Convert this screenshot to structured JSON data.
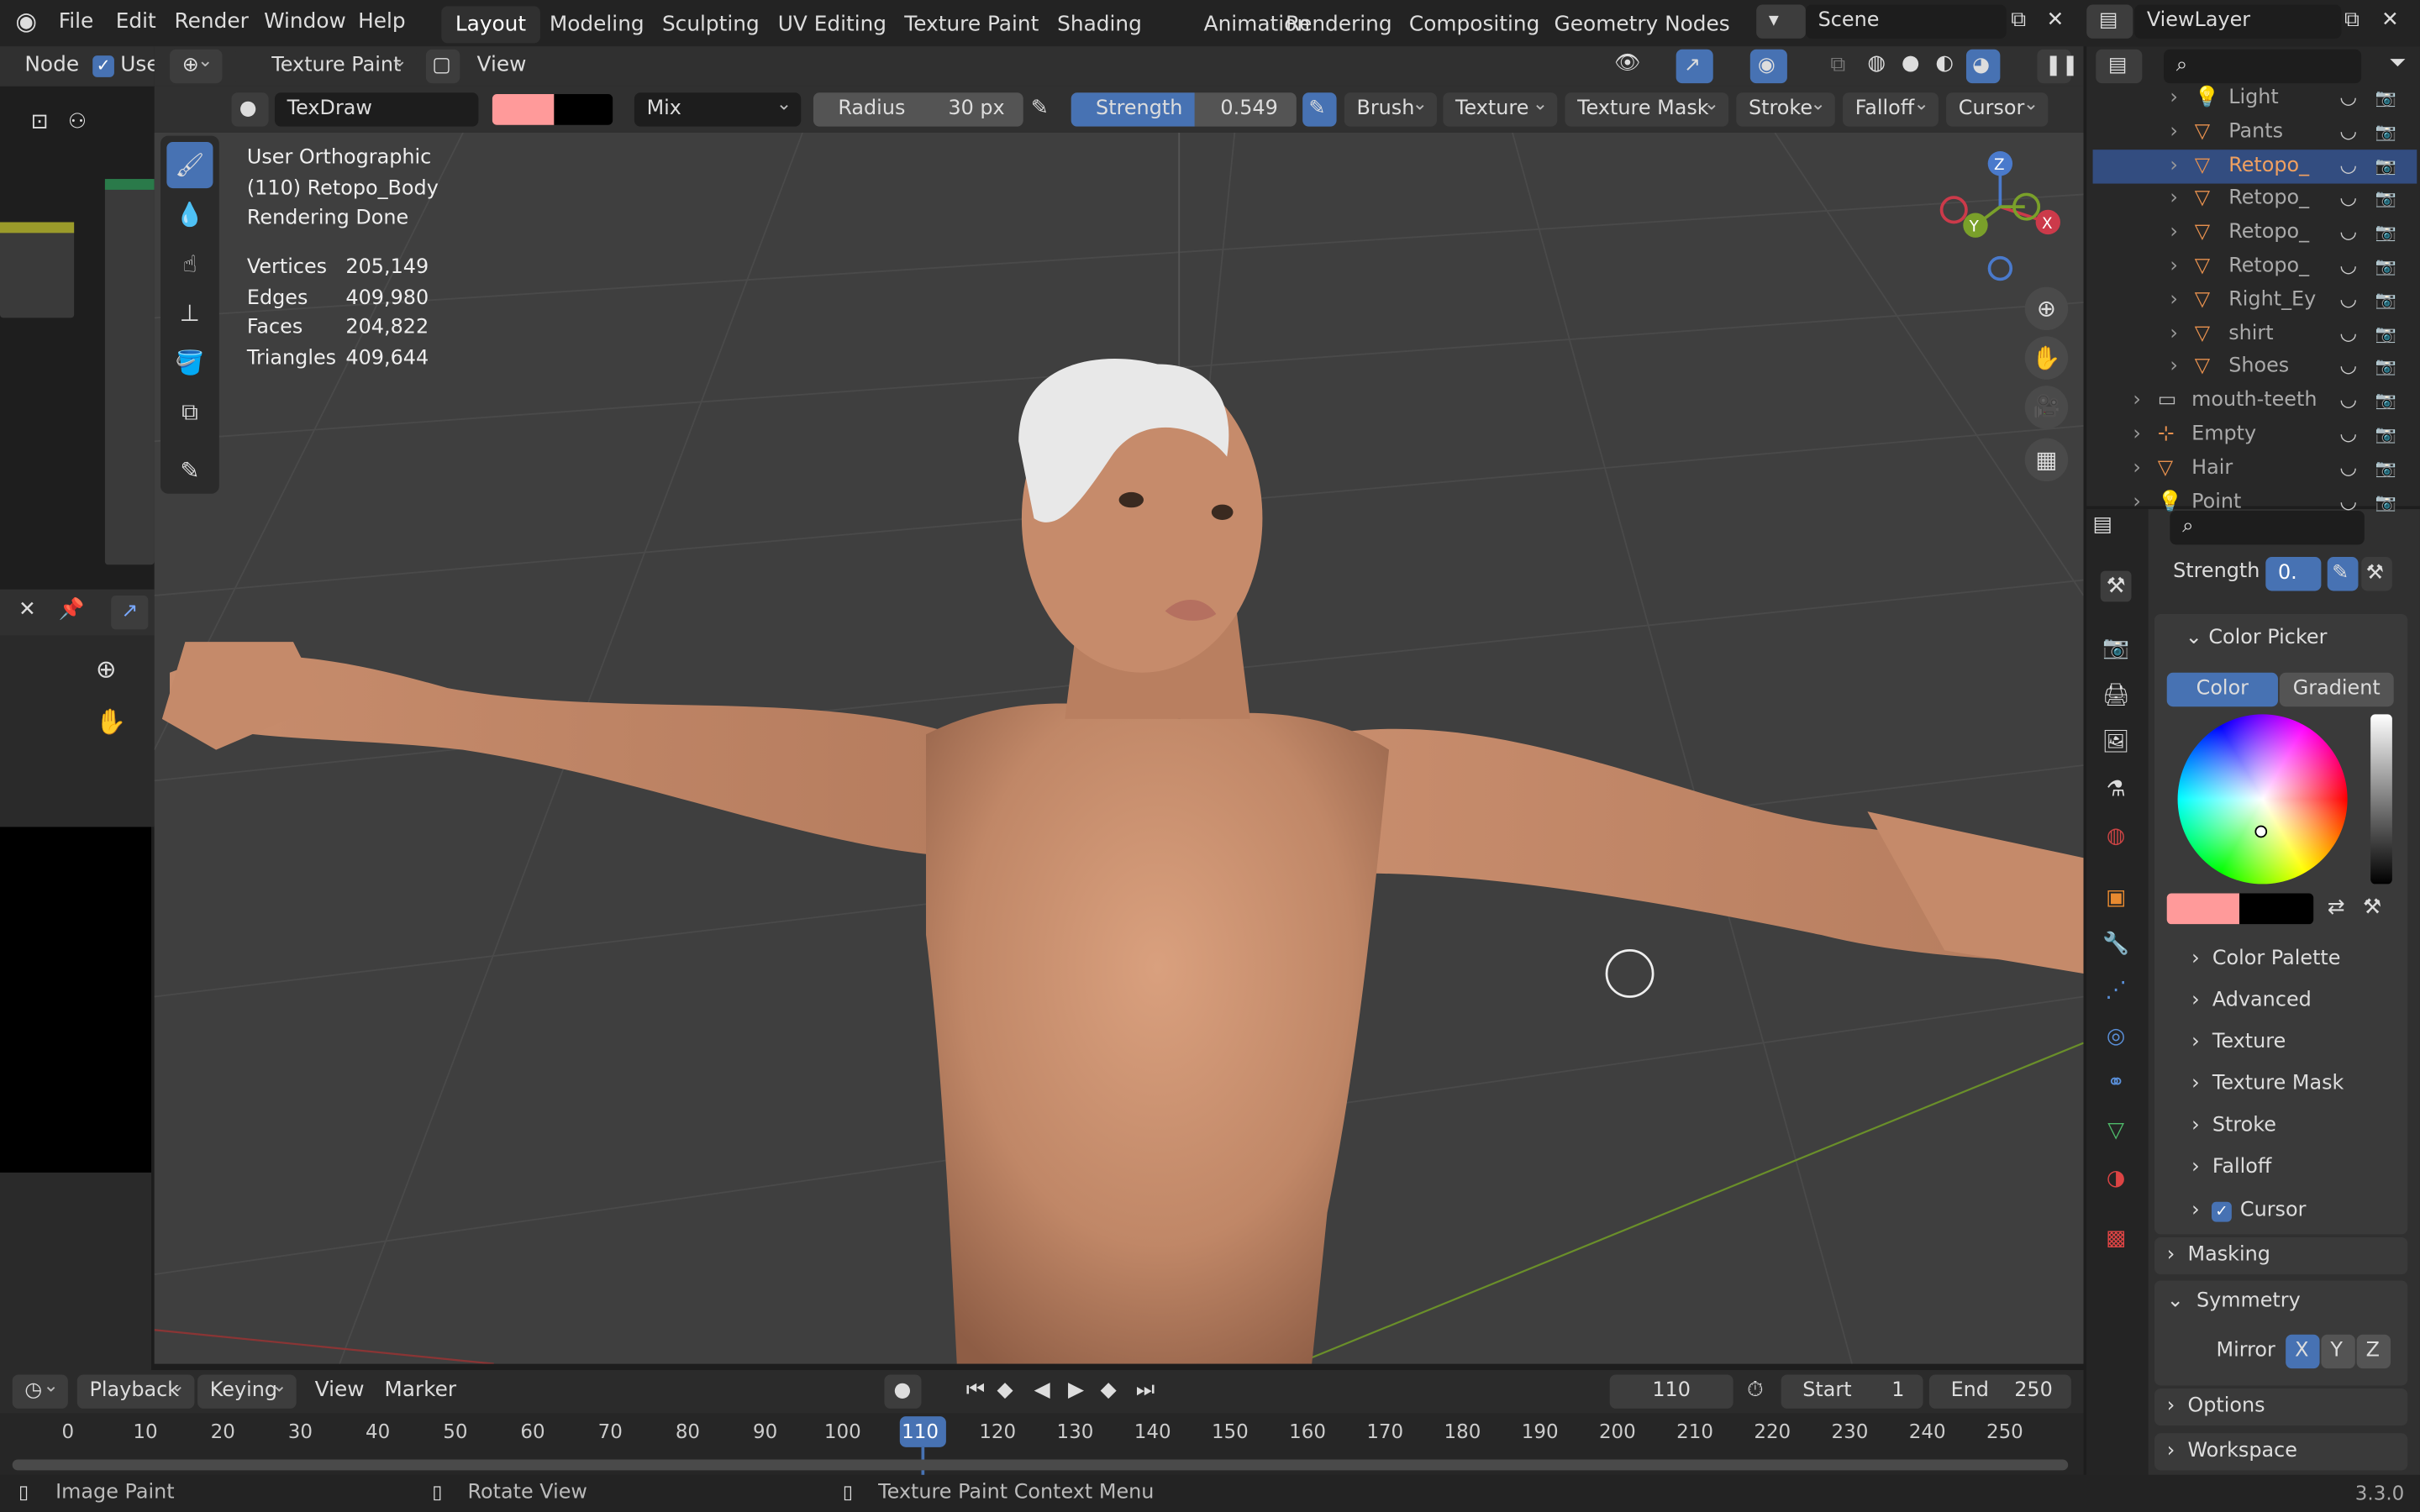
{
  "menu": {
    "file": "File",
    "edit": "Edit",
    "render": "Render",
    "window": "Window",
    "help": "Help"
  },
  "workspaces": [
    "Layout",
    "Modeling",
    "Sculpting",
    "UV Editing",
    "Texture Paint",
    "Shading",
    "Animation",
    "Rendering",
    "Compositing",
    "Geometry Nodes"
  ],
  "scene": "Scene",
  "view_layer": "ViewLayer",
  "node_header": {
    "node": "Node",
    "use_nodes": "Use"
  },
  "viewport_header": {
    "mode": "Texture Paint",
    "view": "View"
  },
  "tool_header": {
    "brush": "TexDraw",
    "blend": "Mix",
    "radius_label": "Radius",
    "radius_value": "30 px",
    "strength_label": "Strength",
    "strength_value": "0.549",
    "brush_menu": "Brush",
    "texture_menu": "Texture",
    "texture_mask_menu": "Texture Mask",
    "stroke_menu": "Stroke",
    "falloff_menu": "Falloff",
    "cursor_menu": "Cursor"
  },
  "overlay_info": {
    "view_name": "User Orthographic",
    "object": "(110) Retopo_Body",
    "render_status": "Rendering Done",
    "stats": [
      {
        "label": "Vertices",
        "value": "205,149"
      },
      {
        "label": "Edges",
        "value": "409,980"
      },
      {
        "label": "Faces",
        "value": "204,822"
      },
      {
        "label": "Triangles",
        "value": "409,644"
      }
    ]
  },
  "gizmo": {
    "z": "Z",
    "y": "Y",
    "x": "X"
  },
  "outliner": [
    {
      "name": "Light",
      "type": "light"
    },
    {
      "name": "Pants",
      "type": "mesh"
    },
    {
      "name": "Retopo_",
      "type": "mesh",
      "selected": true
    },
    {
      "name": "Retopo_",
      "type": "mesh"
    },
    {
      "name": "Retopo_",
      "type": "mesh"
    },
    {
      "name": "Retopo_",
      "type": "mesh"
    },
    {
      "name": "Right_Ey",
      "type": "mesh"
    },
    {
      "name": "shirt",
      "type": "mesh"
    },
    {
      "name": "Shoes",
      "type": "mesh"
    },
    {
      "name": "mouth-teeth",
      "type": "collection"
    },
    {
      "name": "Empty",
      "type": "empty"
    },
    {
      "name": "Hair",
      "type": "mesh"
    },
    {
      "name": "Point",
      "type": "light"
    }
  ],
  "properties": {
    "strength_label": "Strength",
    "strength_value": "0.",
    "color_picker": "Color Picker",
    "color_tab": "Color",
    "gradient_tab": "Gradient",
    "primary_color": "#ff9a9a",
    "secondary_color": "#000000",
    "subpanels": [
      "Color Palette",
      "Advanced",
      "Texture",
      "Texture Mask",
      "Stroke",
      "Falloff",
      "Cursor"
    ],
    "masking": "Masking",
    "symmetry": "Symmetry",
    "mirror": "Mirror",
    "axes": [
      "X",
      "Y",
      "Z"
    ],
    "options": "Options",
    "workspace": "Workspace"
  },
  "timeline": {
    "playback": "Playback",
    "keying": "Keying",
    "view": "View",
    "marker": "Marker",
    "current_frame": "110",
    "start_label": "Start",
    "start": "1",
    "end_label": "End",
    "end": "250",
    "ticks": [
      "0",
      "10",
      "20",
      "30",
      "40",
      "50",
      "60",
      "70",
      "80",
      "90",
      "100",
      "110",
      "120",
      "130",
      "140",
      "150",
      "160",
      "170",
      "180",
      "190",
      "200",
      "210",
      "220",
      "230",
      "240",
      "250"
    ]
  },
  "statusbar": {
    "left": "Image Paint",
    "middle": "Rotate View",
    "right": "Texture Paint Context Menu",
    "version": "3.3.0"
  },
  "colors": {
    "accent": "#4772b3",
    "primary_paint": "#ff9a9a",
    "skin": "#c89272"
  }
}
